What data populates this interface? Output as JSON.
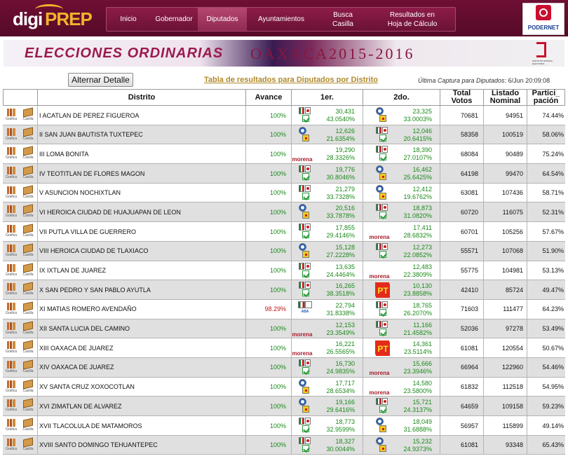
{
  "logo": {
    "part1": "digi",
    "part2": "PREP"
  },
  "nav": [
    {
      "label": "Inicio",
      "active": false
    },
    {
      "label": "Gobernador",
      "active": false
    },
    {
      "label": "Diputados",
      "active": true
    },
    {
      "label": "Ayuntamientos",
      "active": false
    },
    {
      "label": "Busca\nCasilla",
      "active": false
    },
    {
      "label": "Resultados en\nHoja de Cálculo",
      "active": false
    }
  ],
  "podernet": {
    "label": "PODERNET"
  },
  "banner": {
    "left": "ELECCIONES  ORDINARIAS",
    "right": "OAXACA2015-2016",
    "seal_text": "INSTITUTO ESTATAL ELECTORAL"
  },
  "toolbar": {
    "toggle_label": "Alternar Detalle",
    "title": "Tabla de resultados para Diputados por Distrito",
    "capture_label": "Última Captura para Diputados:",
    "capture_value": "6/Jun 20:09:08"
  },
  "colors": {
    "header_bar": "#6e0f34",
    "green_value": "#1a8a1a",
    "red_value": "#c01818",
    "row_alt": "#e0e0e0"
  },
  "icon_labels": {
    "chart": "Grafica",
    "box": "Casilla"
  },
  "table": {
    "headers": {
      "distrito": "Distrito",
      "avance": "Avance",
      "first": "1er.",
      "second": "2do.",
      "total": "Total\nVotos",
      "listado": "Listado\nNominal",
      "particip": "Partici_\npación"
    },
    "rows": [
      {
        "distrito": "I ACATLAN DE PEREZ FIGUEROA",
        "avance": "100%",
        "p1": "coal",
        "v1": "30,431",
        "pct1": "43.0540%",
        "p2": "pan",
        "v2": "23,325",
        "pct2": "33.0003%",
        "total": "70681",
        "listado": "94951",
        "particip": "74.44%"
      },
      {
        "distrito": "II SAN JUAN BAUTISTA TUXTEPEC",
        "avance": "100%",
        "p1": "pan",
        "v1": "12,626",
        "pct1": "21.6354%",
        "p2": "coal",
        "v2": "12,046",
        "pct2": "20.6415%",
        "total": "58358",
        "listado": "100519",
        "particip": "58.06%"
      },
      {
        "distrito": "III LOMA BONITA",
        "avance": "100%",
        "p1": "morena",
        "v1": "19,290",
        "pct1": "28.3326%",
        "p2": "coal",
        "v2": "18,390",
        "pct2": "27.0107%",
        "total": "68084",
        "listado": "90489",
        "particip": "75.24%"
      },
      {
        "distrito": "IV TEOTITLAN DE FLORES MAGON",
        "avance": "100%",
        "p1": "coal",
        "v1": "19,776",
        "pct1": "30.8046%",
        "p2": "pan",
        "v2": "16,462",
        "pct2": "25.6425%",
        "total": "64198",
        "listado": "99470",
        "particip": "64.54%"
      },
      {
        "distrito": "V ASUNCION NOCHIXTLAN",
        "avance": "100%",
        "p1": "coal",
        "v1": "21,279",
        "pct1": "33.7328%",
        "p2": "pan",
        "v2": "12,412",
        "pct2": "19.6762%",
        "total": "63081",
        "listado": "107436",
        "particip": "58.71%"
      },
      {
        "distrito": "VI HEROICA CIUDAD DE HUAJUAPAN DE LEON",
        "avance": "100%",
        "p1": "pan",
        "v1": "20,516",
        "pct1": "33.7878%",
        "p2": "coal",
        "v2": "18,873",
        "pct2": "31.0820%",
        "total": "60720",
        "listado": "116075",
        "particip": "52.31%"
      },
      {
        "distrito": "VII PUTLA VILLA DE GUERRERO",
        "avance": "100%",
        "p1": "coal",
        "v1": "17,855",
        "pct1": "29.4146%",
        "p2": "morena",
        "v2": "17,411",
        "pct2": "28.6832%",
        "total": "60701",
        "listado": "105256",
        "particip": "57.67%"
      },
      {
        "distrito": "VIII HEROICA CIUDAD DE TLAXIACO",
        "avance": "100%",
        "p1": "pan",
        "v1": "15,128",
        "pct1": "27.2228%",
        "p2": "coal",
        "v2": "12,273",
        "pct2": "22.0852%",
        "total": "55571",
        "listado": "107068",
        "particip": "51.90%"
      },
      {
        "distrito": "IX IXTLAN DE JUAREZ",
        "avance": "100%",
        "p1": "coal",
        "v1": "13,635",
        "pct1": "24.4464%",
        "p2": "morena",
        "v2": "12,483",
        "pct2": "22.3809%",
        "total": "55775",
        "listado": "104981",
        "particip": "53.13%"
      },
      {
        "distrito": "X SAN PEDRO Y SAN PABLO AYUTLA",
        "avance": "100%",
        "p1": "coal",
        "v1": "16,265",
        "pct1": "38.3518%",
        "p2": "pt",
        "v2": "10,130",
        "pct2": "23.8858%",
        "total": "42410",
        "listado": "85724",
        "particip": "49.47%"
      },
      {
        "distrito": "XI MATIAS ROMERO AVENDAÑO",
        "avance": "98.29%",
        "p1": "aba",
        "v1": "22,794",
        "pct1": "31.8338%",
        "p2": "coal",
        "v2": "18,765",
        "pct2": "26.2070%",
        "total": "71603",
        "listado": "111477",
        "particip": "64.23%"
      },
      {
        "distrito": "XII SANTA LUCIA DEL CAMINO",
        "avance": "100%",
        "p1": "morena",
        "v1": "12,153",
        "pct1": "23.3549%",
        "p2": "coal",
        "v2": "11,166",
        "pct2": "21.4582%",
        "total": "52036",
        "listado": "97278",
        "particip": "53.49%"
      },
      {
        "distrito": "XIII OAXACA DE JUAREZ",
        "avance": "100%",
        "p1": "morena",
        "v1": "16,221",
        "pct1": "26.5565%",
        "p2": "pt",
        "v2": "14,361",
        "pct2": "23.5114%",
        "total": "61081",
        "listado": "120554",
        "particip": "50.67%"
      },
      {
        "distrito": "XIV OAXACA DE JUAREZ",
        "avance": "100%",
        "p1": "coal",
        "v1": "16,730",
        "pct1": "24.9835%",
        "p2": "morena",
        "v2": "15,666",
        "pct2": "23.3946%",
        "total": "66964",
        "listado": "122960",
        "particip": "54.46%"
      },
      {
        "distrito": "XV SANTA CRUZ XOXOCOTLAN",
        "avance": "100%",
        "p1": "pan",
        "v1": "17,717",
        "pct1": "28.6534%",
        "p2": "morena",
        "v2": "14,580",
        "pct2": "23.5800%",
        "total": "61832",
        "listado": "112518",
        "particip": "54.95%"
      },
      {
        "distrito": "XVI ZIMATLAN DE ALVAREZ",
        "avance": "100%",
        "p1": "pan",
        "v1": "19,166",
        "pct1": "29.6416%",
        "p2": "coal",
        "v2": "15,721",
        "pct2": "24.3137%",
        "total": "64659",
        "listado": "109158",
        "particip": "59.23%"
      },
      {
        "distrito": "XVII TLACOLULA DE MATAMOROS",
        "avance": "100%",
        "p1": "coal",
        "v1": "18,773",
        "pct1": "32.9599%",
        "p2": "pan",
        "v2": "18,049",
        "pct2": "31.6888%",
        "total": "56957",
        "listado": "115899",
        "particip": "49.14%"
      },
      {
        "distrito": "XVIII SANTO DOMINGO TEHUANTEPEC",
        "avance": "100%",
        "p1": "coal",
        "v1": "18,327",
        "pct1": "30.0044%",
        "p2": "pan",
        "v2": "15,232",
        "pct2": "24.9373%",
        "total": "61081",
        "listado": "93348",
        "particip": "65.43%"
      }
    ]
  }
}
